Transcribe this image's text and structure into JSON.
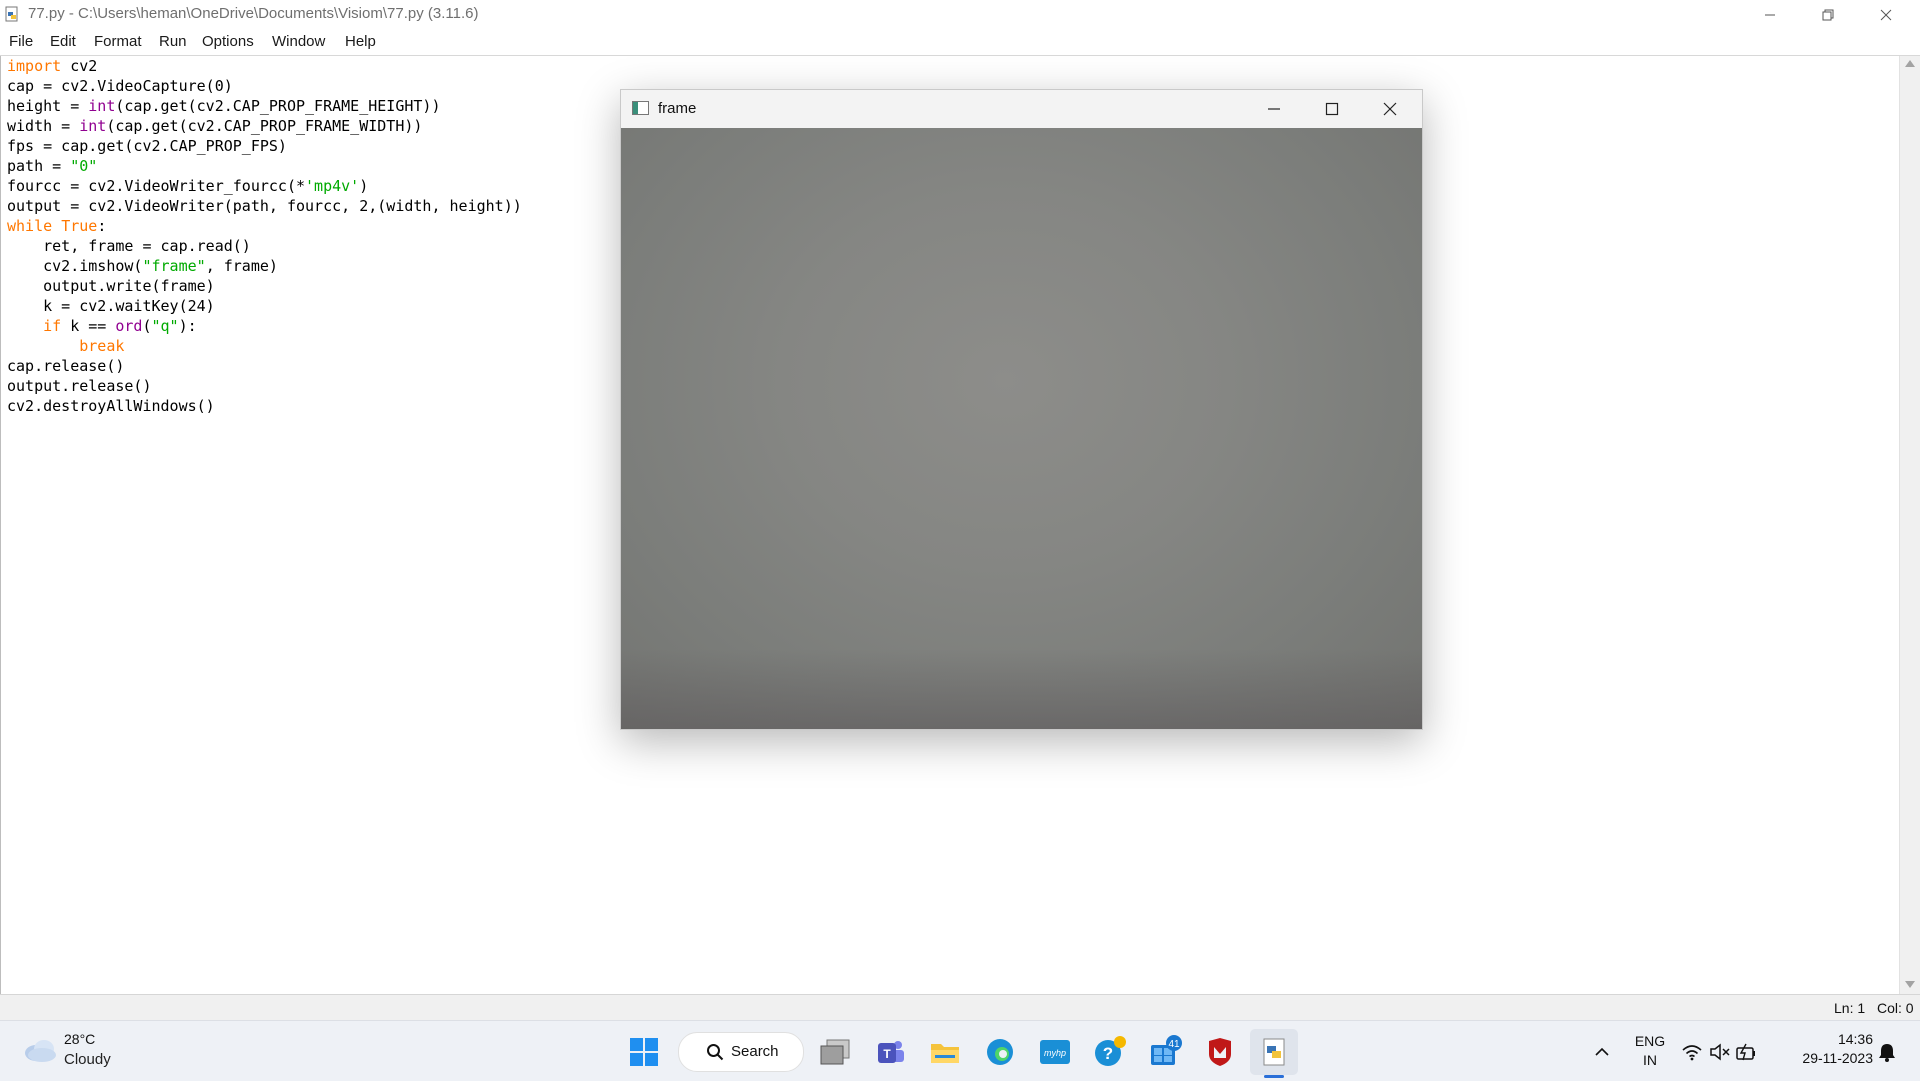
{
  "window": {
    "title": "77.py - C:\\Users\\heman\\OneDrive\\Documents\\Visiom\\77.py (3.11.6)"
  },
  "menu": [
    "File",
    "Edit",
    "Format",
    "Run",
    "Options",
    "Window",
    "Help"
  ],
  "editor": {
    "lines": [
      "import cv2",
      "cap = cv2.VideoCapture(0)",
      "height = int(cap.get(cv2.CAP_PROP_FRAME_HEIGHT))",
      "width = int(cap.get(cv2.CAP_PROP_FRAME_WIDTH))",
      "fps = cap.get(cv2.CAP_PROP_FPS)",
      "path = \"0\"",
      "fourcc = cv2.VideoWriter_fourcc(*'mp4v')",
      "output = cv2.VideoWriter(path, fourcc, 2,(width, height))",
      "while True:",
      "    ret, frame = cap.read()",
      "    cv2.imshow(\"frame\", frame)",
      "    output.write(frame)",
      "    k = cv2.waitKey(24)",
      "    if k == ord(\"q\"):",
      "        break",
      "cap.release()",
      "output.release()",
      "cv2.destroyAllWindows()"
    ],
    "syntax_colors": {
      "keyword": "#ff7700",
      "builtin": "#900090",
      "string": "#00aa00",
      "default": "#000000"
    }
  },
  "status": {
    "line": "Ln: 1",
    "col": "Col: 0"
  },
  "frame_window": {
    "title": "frame"
  },
  "taskbar": {
    "weather": {
      "temp": "28°C",
      "desc": "Cloudy",
      "icon": "cloud-icon"
    },
    "search_label": "Search",
    "pinned": [
      {
        "name": "start-icon"
      },
      {
        "name": "task-view-icon"
      },
      {
        "name": "teams-icon"
      },
      {
        "name": "file-explorer-icon"
      },
      {
        "name": "edge-icon"
      },
      {
        "name": "myhp-icon",
        "label": "myhp"
      },
      {
        "name": "get-help-icon"
      },
      {
        "name": "store-icon",
        "badge": "41"
      },
      {
        "name": "mcafee-icon"
      },
      {
        "name": "python-idle-icon"
      }
    ],
    "tray": {
      "lang_top": "ENG",
      "lang_bottom": "IN",
      "time": "14:36",
      "date": "29-11-2023"
    }
  }
}
